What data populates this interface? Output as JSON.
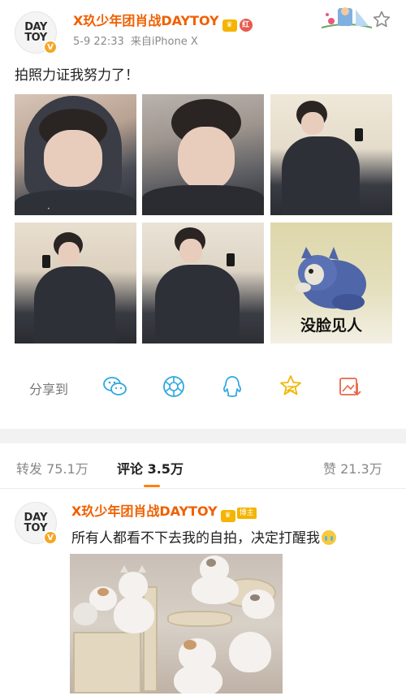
{
  "post": {
    "avatar_logo_line1": "DAY",
    "avatar_logo_line2": "TOY",
    "verified_badge": "V",
    "username": "X玖少年团肖战DAYTOY",
    "red_badge": "红",
    "date": "5-9 22:33",
    "source": "来自iPhone X",
    "text": "拍照力证我努力了！",
    "images": [
      {
        "name": "hooded-selfie"
      },
      {
        "name": "closeup-selfie"
      },
      {
        "name": "mirror-selfie-sitting"
      },
      {
        "name": "mirror-selfie-phone"
      },
      {
        "name": "mirror-selfie-couch"
      },
      {
        "name": "tom-cat-meme",
        "caption": "没脸见人"
      }
    ]
  },
  "share": {
    "label": "分享到",
    "icons": [
      "wechat-icon",
      "moments-icon",
      "qq-icon",
      "qzone-icon",
      "save-image-icon"
    ],
    "accent": "#2ea7e0",
    "qzone_color": "#f2b705"
  },
  "stats": {
    "repost_label": "转发",
    "repost_count": "75.1万",
    "comment_label": "评论",
    "comment_count": "3.5万",
    "like_label": "赞",
    "like_count": "21.3万",
    "active_tab": "comment",
    "accent": "#ff8200"
  },
  "comment": {
    "avatar_logo_line1": "DAY",
    "avatar_logo_line2": "TOY",
    "verified_badge": "V",
    "username": "X玖少年团肖战DAYTOY",
    "author_badge": "博主",
    "text": "所有人都看不下去我的自拍，决定打醒我",
    "emoji": "crying-face",
    "image": "cats-on-cat-tree"
  },
  "colors": {
    "username": "#f06000",
    "meta": "#8a8a8a",
    "separator": "#f2f2f2"
  }
}
